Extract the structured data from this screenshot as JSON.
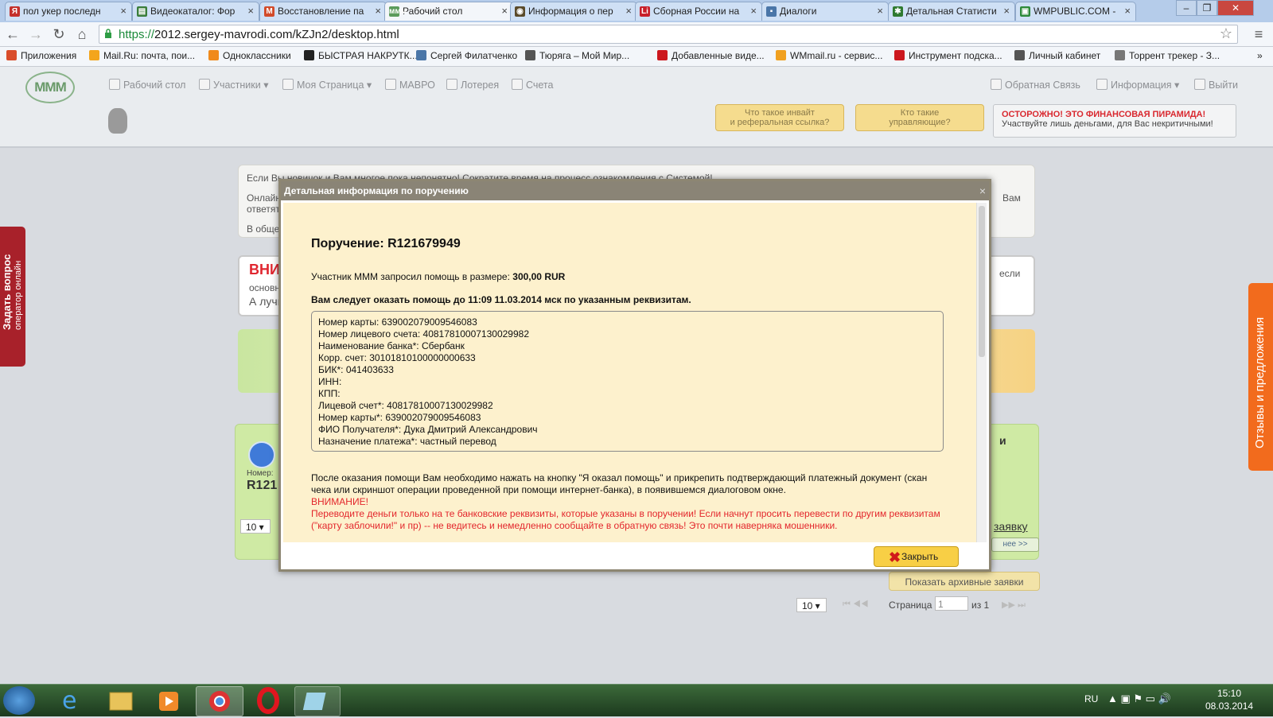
{
  "browser": {
    "tabs": [
      {
        "label": "пол укер последн",
        "icon_color": "#c4302b",
        "icon_char": "Я"
      },
      {
        "label": "Видеокаталог: Фор",
        "icon_color": "#3a7d3a",
        "icon_char": "▤"
      },
      {
        "label": "Восстановление па",
        "icon_color": "#d24b2a",
        "icon_char": "M"
      },
      {
        "label": "Рабочий стол",
        "icon_color": "#5b9b5b",
        "icon_char": "ммм"
      },
      {
        "label": "Информация о пер",
        "icon_color": "#5a4a2a",
        "icon_char": "◉"
      },
      {
        "label": "Сборная России на",
        "icon_color": "#c8202a",
        "icon_char": "Li"
      },
      {
        "label": "Диалоги",
        "icon_color": "#4a76a8",
        "icon_char": "▪"
      },
      {
        "label": "Детальная Статисти",
        "icon_color": "#2f7a2f",
        "icon_char": "✱"
      },
      {
        "label": "WMPUBLIC.COM -",
        "icon_color": "#2d8a3a",
        "icon_char": "▣"
      }
    ],
    "url_scheme": "https://",
    "url_rest": "2012.sergey-mavrodi.com/kZJn2/desktop.html",
    "bookmarks": [
      {
        "label": "Приложения",
        "color": "#d94d2b"
      },
      {
        "label": "Mail.Ru: почта, пои...",
        "color": "#f3a51c"
      },
      {
        "label": "Одноклассники",
        "color": "#f08a1c"
      },
      {
        "label": "БЫСТРАЯ НАКРУТК...",
        "color": "#222222"
      },
      {
        "label": "Сергей Филатченко",
        "color": "#4a76a8"
      },
      {
        "label": "Тюряга – Мой Мир...",
        "color": "#555555"
      },
      {
        "label": "Добавленные виде...",
        "color": "#cc181e"
      },
      {
        "label": "WMmail.ru - сервис...",
        "color": "#f0a020"
      },
      {
        "label": "Инструмент подска...",
        "color": "#cc181e"
      },
      {
        "label": "Личный кабинет",
        "color": "#555555"
      },
      {
        "label": "Торрент трекер - З...",
        "color": "#777777"
      }
    ]
  },
  "site": {
    "logo_text": "MMM",
    "nav": [
      "Рабочий стол",
      "Участники ▾",
      "Моя Страница ▾",
      "МАВРО",
      "Лотерея",
      "Счета"
    ],
    "nav_right": [
      "Обратная Связь",
      "Информация ▾",
      "Выйти"
    ],
    "btn_invite": [
      "Что такое инвайт",
      "и реферальная ссылка?"
    ],
    "btn_managers": [
      "Кто такие",
      "управляющие?"
    ],
    "warning_title": "ОСТОРОЖНО! ЭТО ФИНАНСОВАЯ ПИРАМИДА!",
    "warning_text": "Участвуйте лишь деньгами, для Вас некритичными!"
  },
  "background": {
    "notice_line1": "Если Вы новичок и Вам многое пока непонятно! Сократите время на процесс ознакомления с Системой!",
    "notice_line2a": "Онлайн",
    "notice_line2b": "ответят",
    "notice_line2c": "Вам",
    "notice_line3": "В обще",
    "alert_title": "ВНИ",
    "alert_line1": "основн",
    "alert_line2": "А лучш",
    "alert_right": "если",
    "order_number_label": "Номер:",
    "order_number": "R121",
    "right_title_fragment": "и",
    "link_request": "заявку",
    "btn_more": "нее >>",
    "archive_btn": "Показать архивные заявки",
    "per_page": "10 ▾",
    "page_label": "Страница",
    "page_value": "1",
    "page_of": "из 1"
  },
  "side": {
    "left_title": "Задать вопрос",
    "left_sub": "оператор онлайн",
    "right_title": "Отзывы и предложения"
  },
  "modal": {
    "header": "Детальная информация по поручению",
    "close_x": "×",
    "order_title": "Поручение: R121679949",
    "request_text": "Участник МММ запросил помощь в размере:",
    "request_amount": "300,00 RUR",
    "deadline": "Вам следует оказать помощь до 11:09 11.03.2014 мск по указанным реквизитам.",
    "details": [
      "Номер карты: 639002079009546083",
      "Номер лицевого счета: 40817810007130029982",
      "Наименование банка*: Сбербанк",
      "Корр. счет: 30101810100000000633",
      "БИК*: 041403633",
      "ИНН:",
      "КПП:",
      "Лицевой счет*: 40817810007130029982",
      "Номер карты*: 639002079009546083",
      "ФИО Получателя*: Дука Дмитрий Александрович",
      "Назначение платежа*: частный перевод"
    ],
    "after_text_1": "После оказания помощи Вам необходимо нажать на кнопку \"Я оказал помощь\" и прикрепить подтверждающий платежный документ (скан",
    "after_text_2": "чека или скриншот операции проведенной при помощи интернет-банка), в появившемся диалоговом окне.",
    "warning_label": "ВНИМАНИЕ!",
    "warning_1": "Переводите деньги только на те банковские реквизиты, которые указаны в поручении! Если начнут просить перевести по другим реквизитам",
    "warning_2": "(\"карту заблочили!\" и пр) -- не ведитесь и немедленно сообщайте в обратную связь! Это почти наверняка мошенники.",
    "close_button": "Закрыть"
  },
  "taskbar": {
    "lang": "RU",
    "time": "15:10",
    "date": "08.03.2014"
  }
}
